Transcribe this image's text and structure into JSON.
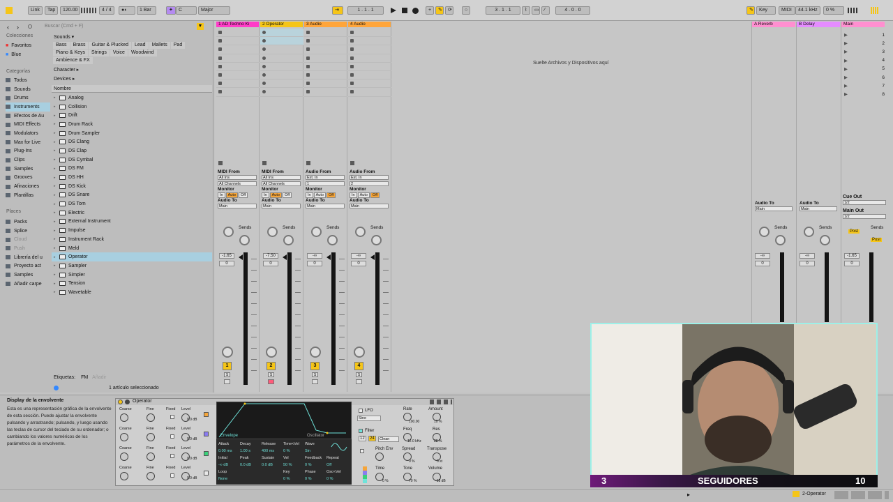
{
  "toolbar": {
    "link": "Link",
    "tap": "Tap",
    "tempo": "120.00",
    "meter": "4 / 4",
    "quant": "1 Bar",
    "key_root": "C",
    "scale": "Major",
    "position": "1 . 1 . 1",
    "loop_start": "3 . 1 . 1",
    "loop_len": "4 . 0 . 0",
    "key_btn": "Key",
    "midi_btn": "MIDI",
    "sample_rate": "44.1 kHz",
    "cpu": "0 %"
  },
  "browser": {
    "search_placeholder": "Buscar (Cmd + F)",
    "collections_title": "Colecciones",
    "collections": [
      "Favoritos",
      "Blue"
    ],
    "categories_title": "Categorías",
    "categories": [
      "Todos",
      "Sounds",
      "Drums",
      "Instruments",
      "Efectos de Au",
      "MIDI Effects",
      "Modulators",
      "Max for Live",
      "Plug-Ins",
      "Clips",
      "Samples",
      "Grooves",
      "Afinaciones",
      "Plantillas"
    ],
    "places_title": "Places",
    "places": [
      "Packs",
      "Splice",
      "Cloud",
      "Push",
      "Librería del u",
      "Proyecto act",
      "Samples",
      "Añadir carpe"
    ],
    "sounds_label": "Sounds ▾",
    "sound_tags_row1": [
      "Bass",
      "Brass",
      "Guitar & Plucked",
      "Lead",
      "Mallets",
      "Pad"
    ],
    "sound_tags_row2": [
      "Piano & Keys",
      "Strings",
      "Voice",
      "Woodwind"
    ],
    "sound_tags_row3": [
      "Ambience & FX"
    ],
    "character_label": "Character ▸",
    "devices_label": "Devices ▸",
    "name_header": "Nombre",
    "items": [
      "Analog",
      "Collision",
      "Drift",
      "Drum Rack",
      "Drum Sampler",
      "DS Clang",
      "DS Clap",
      "DS Cymbal",
      "DS FM",
      "DS HH",
      "DS Kick",
      "DS Snare",
      "DS Tom",
      "Electric",
      "External Instrument",
      "Impulse",
      "Instrument Rack",
      "Meld",
      "Operator",
      "Sampler",
      "Simpler",
      "Tension",
      "Wavetable"
    ],
    "selected_item": "Operator",
    "labels_label": "Etiquetas:",
    "fm_tag": "FM",
    "add_tag": "Añadir",
    "status": "1 artículo seleccionado"
  },
  "tracks": [
    {
      "name": "1 AD Techno Ki",
      "color": "#ff3cc8",
      "vol": "-1.65",
      "pan": "0",
      "num": "1"
    },
    {
      "name": "2 Operator",
      "color": "#f5c518",
      "vol": "-7.50",
      "pan": "0",
      "num": "2"
    },
    {
      "name": "3 Audio",
      "color": "#ffa53a",
      "vol": "-∞",
      "pan": "0",
      "num": "3"
    },
    {
      "name": "4 Audio",
      "color": "#ffa53a",
      "vol": "-∞",
      "pan": "0",
      "num": "4"
    }
  ],
  "io": {
    "midi_from": "MIDI From",
    "audio_from": "Audio From",
    "all_ins": "All Ins",
    "all_channels": "All Channels",
    "ext_in": "Ext. In",
    "in1": "1",
    "in2": "2",
    "monitor": "Monitor",
    "in": "In",
    "auto": "Auto",
    "off": "Off",
    "audio_to": "Audio To",
    "main": "Main",
    "sends": "Sends",
    "cue_out": "Cue Out",
    "cue_val": "1/2",
    "main_out": "Main Out",
    "main_val": "1/2",
    "post": "Post"
  },
  "drop_hint": "Suelte Archivos y Dispositivos aquí",
  "returns": [
    {
      "name": "A Reverb",
      "color": "#ff8fd0",
      "vol": "-∞",
      "pan": "0"
    },
    {
      "name": "B Delay",
      "color": "#e58cff",
      "vol": "-∞",
      "pan": "0"
    },
    {
      "name": "Main",
      "color": "#ff8fd0",
      "vol": "-1.65",
      "pan": "0"
    }
  ],
  "scene_numbers": [
    "1",
    "2",
    "3",
    "4",
    "5",
    "6",
    "7",
    "8"
  ],
  "info": {
    "title": "Display de la envolvente",
    "body": "Esta es una representación gráfica de la envolvente de esta sección. Puede ajustar la envolvente pulsando y arrastrando; pulsando, y luego usando las teclas de cursor del teclado de su ordenador; o cambiando los valores numéricos de los parámetros de la envolvente."
  },
  "operator": {
    "title": "Operator",
    "coarse": "Coarse",
    "fine": "Fine",
    "fixed": "Fixed",
    "level": "Level",
    "level_val": "0.0 dB",
    "envelope": "Envelope",
    "oscillator": "Oscillator",
    "attack": "Attack",
    "decay": "Decay",
    "release": "Release",
    "time_vel": "Time<Vel",
    "wave": "Wave",
    "attack_val": "0.00 ms",
    "decay_val": "1.00 s",
    "release_val": "400 ms",
    "time_vel_val": "0 %",
    "wave_val": "Sin",
    "initial": "Initial",
    "peak": "Peak",
    "sustain": "Sustain",
    "vel": "Vel",
    "feedback": "Feedback",
    "repeat": "Repeat",
    "initial_val": "-∞ dB",
    "peak_val": "0.0 dB",
    "sustain_val": "0.0 dB",
    "vel_val": "50 %",
    "feedback_val": "0 %",
    "repeat_val": "Off",
    "loop": "Loop",
    "loop_val": "None",
    "key": "Key",
    "key_val": "0 %",
    "phase": "Phase",
    "phase_val": "0 %",
    "osc_vel": "Osc<Vel",
    "osc_vel_val": "0 %",
    "lfo": "LFO",
    "rate": "Rate",
    "amount": "Amount",
    "lfo_wave": "Sine",
    "rate_val": "100.00",
    "amount_val": "10 %",
    "filter": "Filter",
    "filter_type": "Clean",
    "freq": "Freq",
    "res": "Res",
    "freq_val": "12.0 kHz",
    "res_val": "28 %",
    "pitch_env": "Pitch Env",
    "spread": "Spread",
    "transpose": "Transpose",
    "spread_val": "0 %",
    "transpose_val": "0 st",
    "time": "Time",
    "tone": "Tone",
    "volume": "Volume",
    "time_val": "0 %",
    "tone_val": "70 %",
    "volume_val": "-18 dB",
    "f12": "12",
    "f24": "24"
  },
  "overlay": {
    "left_num": "3",
    "label": "SEGUIDORES",
    "right_num": "10"
  },
  "bottom": {
    "track_label": "2-Operator"
  }
}
